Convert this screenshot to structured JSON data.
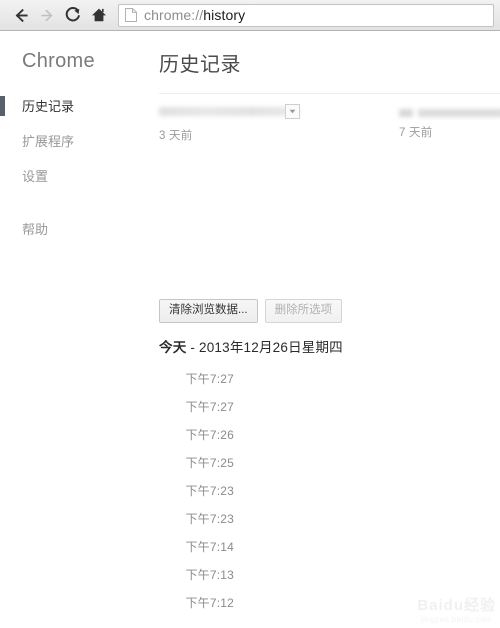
{
  "browser": {
    "back_label": "Back",
    "forward_label": "Forward",
    "reload_label": "Reload",
    "home_label": "Home",
    "address": {
      "scheme": "chrome://",
      "host": "history",
      "full": "chrome://history",
      "page_icon": "document-icon"
    }
  },
  "sidebar": {
    "brand": "Chrome",
    "items": [
      {
        "label": "历史记录",
        "selected": true
      },
      {
        "label": "扩展程序",
        "selected": false
      },
      {
        "label": "设置",
        "selected": false
      },
      {
        "label": "帮助",
        "selected": false
      }
    ]
  },
  "main": {
    "title": "历史记录",
    "recent_entries": [
      {
        "age": "3 天前",
        "has_menu": true
      },
      {
        "age": "7 天前",
        "has_menu": false
      }
    ],
    "buttons": {
      "clear_browsing_data": "清除浏览数据...",
      "remove_selected": "删除所选项"
    },
    "day_header": {
      "today": "今天",
      "separator": " - ",
      "date": "2013年12月26日星期四"
    },
    "history_rows": [
      {
        "time": "下午7:27"
      },
      {
        "time": "下午7:27"
      },
      {
        "time": "下午7:26"
      },
      {
        "time": "下午7:25"
      },
      {
        "time": "下午7:23"
      },
      {
        "time": "下午7:23"
      },
      {
        "time": "下午7:14"
      },
      {
        "time": "下午7:13"
      },
      {
        "time": "下午7:12"
      }
    ]
  },
  "watermark": {
    "main_a": "Bai",
    "main_b": "du",
    "main_c": "经验",
    "sub": "jingyan.baidu.com"
  },
  "colors": {
    "selection_bar": "#58606b",
    "toolbar_bg": "#ececec",
    "text_primary": "#333333",
    "text_muted": "#999999"
  }
}
